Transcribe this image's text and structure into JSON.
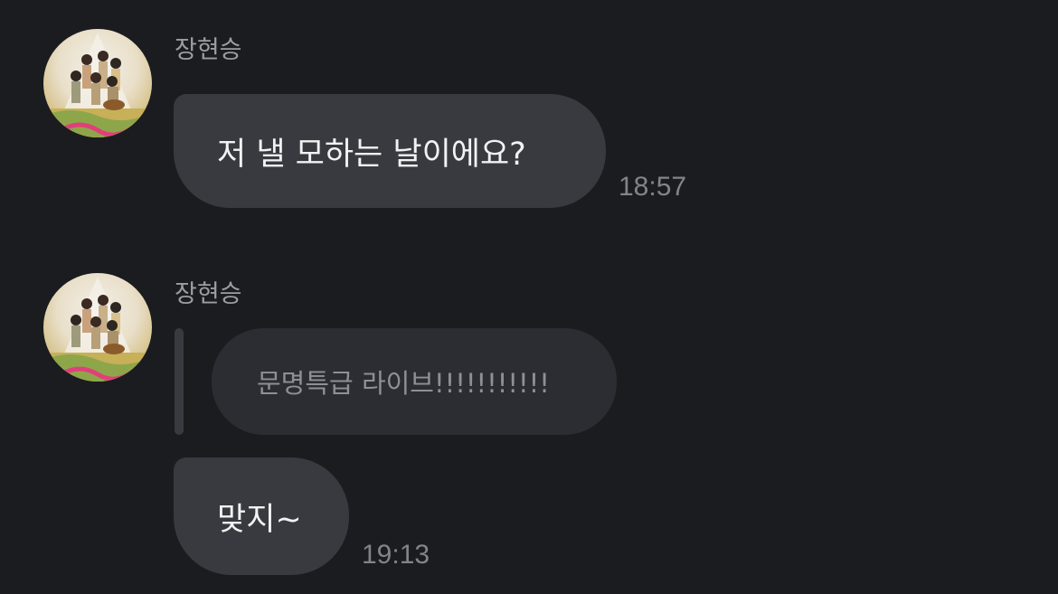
{
  "messages": [
    {
      "sender": "장현승",
      "text": "저 낼 모하는 날이에요?",
      "time": "18:57"
    },
    {
      "sender": "장현승",
      "quote": "문명특급 라이브!!!!!!!!!!!",
      "text": "맞지~",
      "time": "19:13"
    }
  ]
}
